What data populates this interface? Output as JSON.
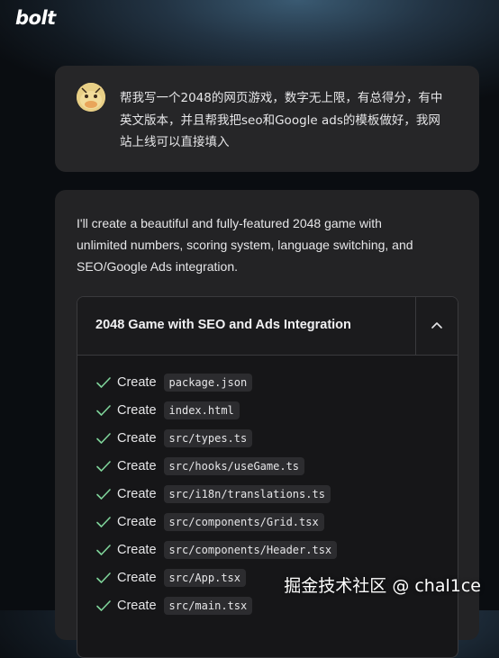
{
  "app": {
    "logo": "bolt"
  },
  "user_message": {
    "lines": [
      "帮我写一个2048的网页游戏，数字无上限，有总得分，有中",
      "英文版本，并且帮我把seo和Google ads的模板做好，我网",
      "站上线可以直接填入"
    ]
  },
  "assistant_message": {
    "intro_lines": [
      "I'll create a beautiful and fully-featured 2048 game with",
      "unlimited numbers, scoring system, language switching, and",
      "SEO/Google Ads integration."
    ],
    "artifact": {
      "title": "2048 Game with SEO and Ads Integration",
      "steps": [
        {
          "action": "Create",
          "file": "package.json"
        },
        {
          "action": "Create",
          "file": "index.html"
        },
        {
          "action": "Create",
          "file": "src/types.ts"
        },
        {
          "action": "Create",
          "file": "src/hooks/useGame.ts"
        },
        {
          "action": "Create",
          "file": "src/i18n/translations.ts"
        },
        {
          "action": "Create",
          "file": "src/components/Grid.tsx"
        },
        {
          "action": "Create",
          "file": "src/components/Header.tsx"
        },
        {
          "action": "Create",
          "file": "src/App.tsx"
        },
        {
          "action": "Create",
          "file": "src/main.tsx"
        }
      ]
    }
  },
  "watermark": "掘金技术社区 @ chal1ce",
  "colors": {
    "check": "#7fd49a",
    "card_bg": "#262628"
  }
}
